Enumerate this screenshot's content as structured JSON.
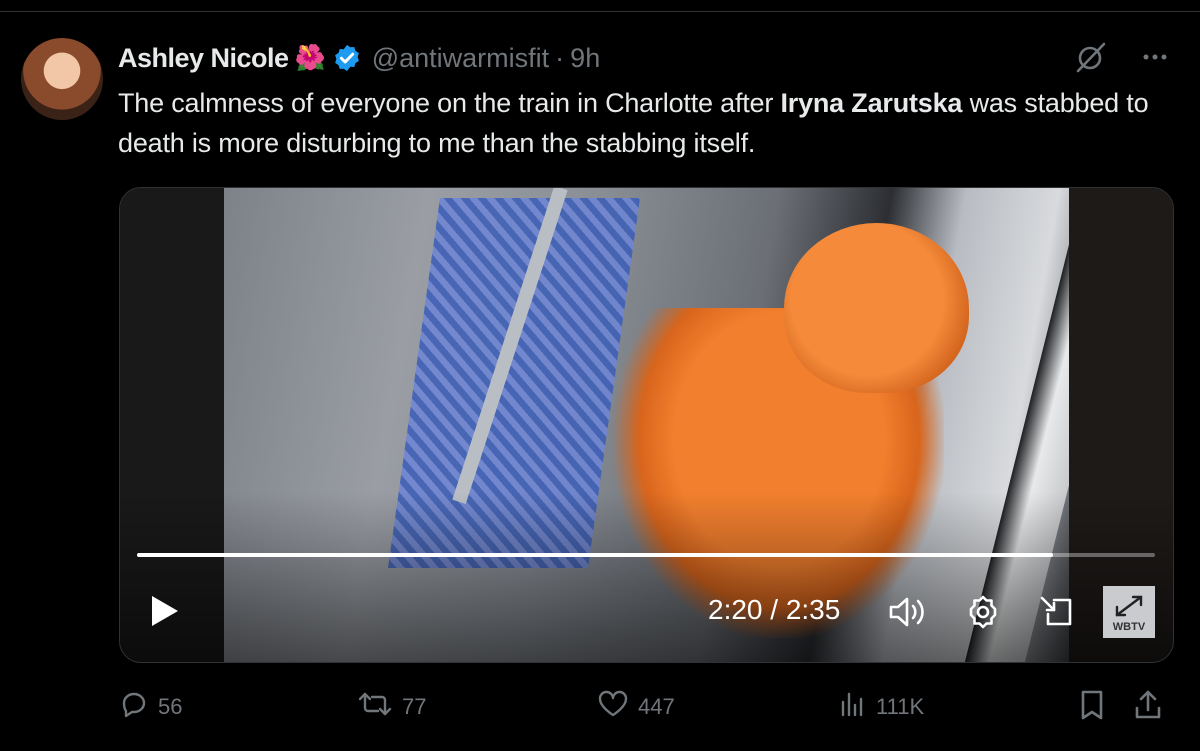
{
  "author": {
    "display_name": "Ashley Nicole",
    "emoji": "🌺",
    "handle": "@antiwarmisfit",
    "separator": "·",
    "time": "9h"
  },
  "post": {
    "text_before": "The calmness of everyone on the train in Charlotte after ",
    "text_bold": "Iryna Zarutska",
    "text_after": " was stabbed to death is more disturbing to me than the stabbing itself."
  },
  "video": {
    "progress_fraction": 0.9,
    "time_readout": "2:20 / 2:35",
    "watermark": "WBTV"
  },
  "actions": {
    "replies": "56",
    "reposts": "77",
    "likes": "447",
    "views": "111K"
  },
  "colors": {
    "background": "#000000",
    "muted": "#71767b",
    "text": "#e7e9ea",
    "verified": "#1d9bf0"
  },
  "icons": [
    "grok-icon",
    "more-icon",
    "play-icon",
    "volume-icon",
    "settings-icon",
    "pip-icon",
    "fullscreen-icon",
    "reply-icon",
    "repost-icon",
    "like-icon",
    "views-icon",
    "bookmark-icon",
    "share-icon"
  ]
}
